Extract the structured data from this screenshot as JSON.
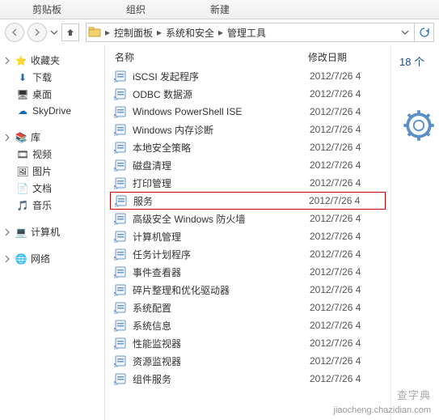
{
  "ribbon": {
    "tabs": [
      "剪贴板",
      "组织",
      "新建",
      ""
    ]
  },
  "breadcrumbs": [
    "控制面板",
    "系统和安全",
    "管理工具"
  ],
  "sidebar": {
    "favorites": {
      "label": "收藏夹",
      "items": [
        {
          "label": "下载",
          "color": "#1e6bb8"
        },
        {
          "label": "桌面",
          "color": "#444"
        },
        {
          "label": "SkyDrive",
          "color": "#0a6ab6"
        }
      ]
    },
    "libraries": {
      "label": "库",
      "items": [
        {
          "label": "视频",
          "color": "#444"
        },
        {
          "label": "图片",
          "color": "#444"
        },
        {
          "label": "文档",
          "color": "#444"
        },
        {
          "label": "音乐",
          "color": "#444"
        }
      ]
    },
    "computer": {
      "label": "计算机"
    },
    "network": {
      "label": "网络"
    }
  },
  "columns": {
    "name": "名称",
    "date": "修改日期"
  },
  "files": [
    {
      "name": "iSCSI 发起程序",
      "date": "2012/7/26 4",
      "highlight": false
    },
    {
      "name": "ODBC 数据源",
      "date": "2012/7/26 4",
      "highlight": false
    },
    {
      "name": "Windows PowerShell ISE",
      "date": "2012/7/26 4",
      "highlight": false
    },
    {
      "name": "Windows 内存诊断",
      "date": "2012/7/26 4",
      "highlight": false
    },
    {
      "name": "本地安全策略",
      "date": "2012/7/26 4",
      "highlight": false
    },
    {
      "name": "磁盘清理",
      "date": "2012/7/26 4",
      "highlight": false
    },
    {
      "name": "打印管理",
      "date": "2012/7/26 4",
      "highlight": false
    },
    {
      "name": "服务",
      "date": "2012/7/26 4",
      "highlight": true
    },
    {
      "name": "高级安全 Windows 防火墙",
      "date": "2012/7/26 4",
      "highlight": false
    },
    {
      "name": "计算机管理",
      "date": "2012/7/26 4",
      "highlight": false
    },
    {
      "name": "任务计划程序",
      "date": "2012/7/26 4",
      "highlight": false
    },
    {
      "name": "事件查看器",
      "date": "2012/7/26 4",
      "highlight": false
    },
    {
      "name": "碎片整理和优化驱动器",
      "date": "2012/7/26 4",
      "highlight": false
    },
    {
      "name": "系统配置",
      "date": "2012/7/26 4",
      "highlight": false
    },
    {
      "name": "系统信息",
      "date": "2012/7/26 4",
      "highlight": false
    },
    {
      "name": "性能监视器",
      "date": "2012/7/26 4",
      "highlight": false
    },
    {
      "name": "资源监视器",
      "date": "2012/7/26 4",
      "highlight": false
    },
    {
      "name": "组件服务",
      "date": "2012/7/26 4",
      "highlight": false
    }
  ],
  "preview": {
    "count_label": "18 个"
  },
  "watermarks": {
    "line1": "查字典",
    "line2": "jiaocheng.chazidian.com"
  }
}
